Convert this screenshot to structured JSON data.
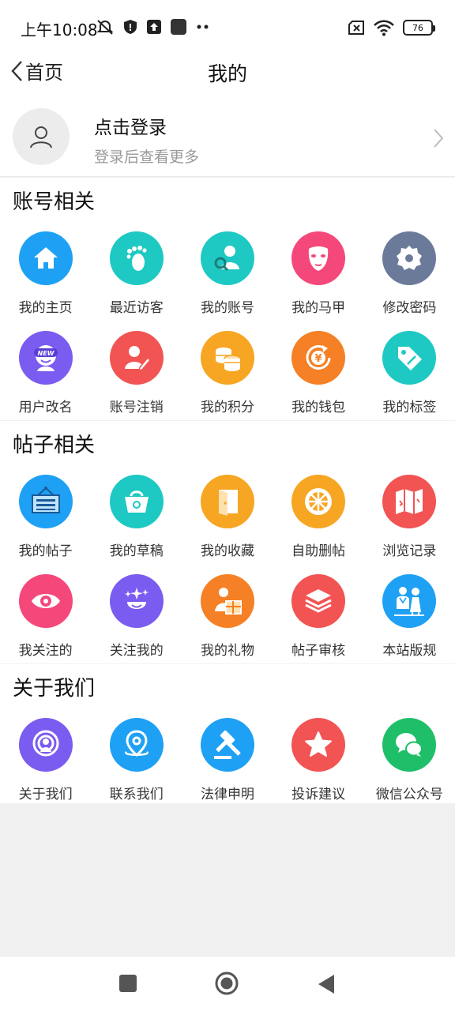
{
  "status_bar": {
    "time": "上午10:08",
    "battery": "76"
  },
  "nav": {
    "back_label": "首页",
    "title": "我的"
  },
  "profile": {
    "title": "点击登录",
    "subtitle": "登录后查看更多"
  },
  "sections": [
    {
      "title": "账号相关",
      "items": [
        {
          "label": "我的主页",
          "icon": "home-icon",
          "color": "#1ea1f4"
        },
        {
          "label": "最近访客",
          "icon": "footprint-icon",
          "color": "#1ec9c3"
        },
        {
          "label": "我的账号",
          "icon": "account-search-icon",
          "color": "#1ec9c3"
        },
        {
          "label": "我的马甲",
          "icon": "mask-icon",
          "color": "#f5487a"
        },
        {
          "label": "修改密码",
          "icon": "gear-icon",
          "color": "#6c7a9a"
        },
        {
          "label": "用户改名",
          "icon": "new-badge-icon",
          "color": "#7b5cf0"
        },
        {
          "label": "账号注销",
          "icon": "user-edit-icon",
          "color": "#f25353"
        },
        {
          "label": "我的积分",
          "icon": "coins-icon",
          "color": "#f6a623"
        },
        {
          "label": "我的钱包",
          "icon": "yuan-refresh-icon",
          "color": "#f58025"
        },
        {
          "label": "我的标签",
          "icon": "tag-icon",
          "color": "#1ec9c3"
        }
      ]
    },
    {
      "title": "帖子相关",
      "items": [
        {
          "label": "我的帖子",
          "icon": "signboard-icon",
          "color": "#1ea1f4"
        },
        {
          "label": "我的草稿",
          "icon": "basket-icon",
          "color": "#1ec9c3"
        },
        {
          "label": "我的收藏",
          "icon": "door-icon",
          "color": "#f6a623"
        },
        {
          "label": "自助删帖",
          "icon": "aperture-icon",
          "color": "#f6a623"
        },
        {
          "label": "浏览记录",
          "icon": "map-icon",
          "color": "#f25353"
        },
        {
          "label": "我关注的",
          "icon": "eye-icon",
          "color": "#f5487a"
        },
        {
          "label": "关注我的",
          "icon": "star-face-icon",
          "color": "#7b5cf0"
        },
        {
          "label": "我的礼物",
          "icon": "gift-person-icon",
          "color": "#f58025"
        },
        {
          "label": "帖子审核",
          "icon": "layers-icon",
          "color": "#f25353"
        },
        {
          "label": "本站版规",
          "icon": "rules-people-icon",
          "color": "#1ea1f4"
        }
      ]
    },
    {
      "title": "关于我们",
      "items": [
        {
          "label": "关于我们",
          "icon": "broadcast-user-icon",
          "color": "#7b5cf0"
        },
        {
          "label": "联系我们",
          "icon": "location-pin-icon",
          "color": "#1ea1f4"
        },
        {
          "label": "法律申明",
          "icon": "gavel-icon",
          "color": "#1ea1f4"
        },
        {
          "label": "投诉建议",
          "icon": "star-icon",
          "color": "#f25353"
        },
        {
          "label": "微信公众号",
          "icon": "wechat-icon",
          "color": "#1fbf6a"
        }
      ]
    }
  ]
}
